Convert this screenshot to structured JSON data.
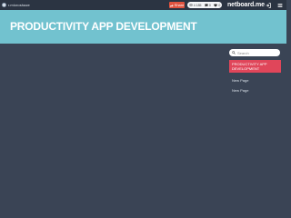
{
  "topbar": {
    "user": {
      "name": "r.microshaze",
      "icon": "avatar"
    },
    "share": {
      "label": "Share",
      "icon": "share-icon"
    },
    "stats": [
      {
        "icon": "eye-icon",
        "value": "4 185"
      },
      {
        "icon": "comment-icon",
        "value": "0"
      },
      {
        "icon": "heart-icon",
        "value": "0"
      }
    ],
    "brand": "netboard.me",
    "icons": [
      "sign-in-icon",
      "menu-icon"
    ]
  },
  "hero": {
    "title": "PRODUCTIVITY APP DEVELOPMENT",
    "color": "#72c2cf"
  },
  "search": {
    "placeholder": "Search",
    "icon": "search-icon"
  },
  "nav": {
    "items": [
      {
        "label": "PRODUCTIVITY APP DEVELOPMENT",
        "active": true
      },
      {
        "label": "New Page",
        "active": false
      },
      {
        "label": "New Page",
        "active": false
      }
    ]
  },
  "colors": {
    "background": "#3a4455",
    "topbar": "#2b3442",
    "accent": "#e0465a",
    "share": "#e0533f"
  }
}
